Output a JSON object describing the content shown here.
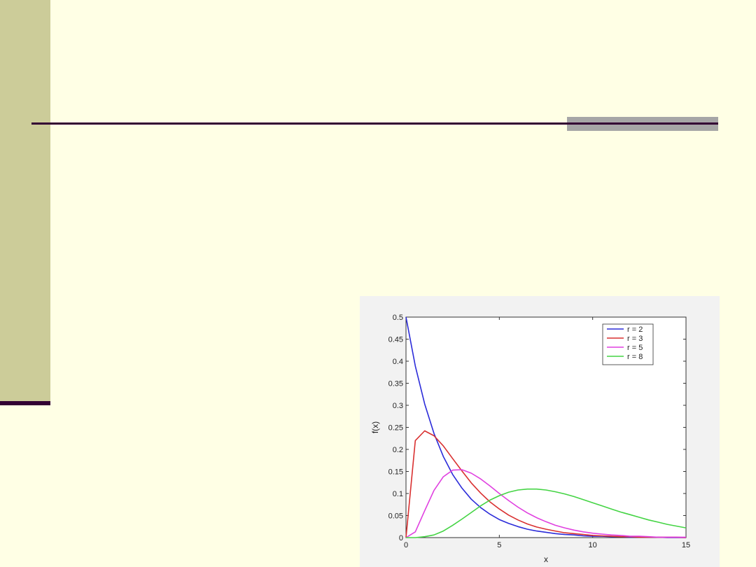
{
  "chart_data": {
    "type": "line",
    "title": "",
    "xlabel": "x",
    "ylabel": "f(x)",
    "xlim": [
      0,
      15
    ],
    "ylim": [
      0,
      0.5
    ],
    "xticks": [
      "0",
      "5",
      "10",
      "15"
    ],
    "yticks": [
      "0",
      "0.05",
      "0.1",
      "0.15",
      "0.2",
      "0.25",
      "0.3",
      "0.35",
      "0.4",
      "0.45",
      "0.5"
    ],
    "xtick_values": [
      0,
      5,
      10,
      15
    ],
    "ytick_values": [
      0,
      0.05,
      0.1,
      0.15,
      0.2,
      0.25,
      0.3,
      0.35,
      0.4,
      0.45,
      0.5
    ],
    "legend_position": "top-right",
    "grid": false,
    "x": [
      0,
      0.5,
      1,
      1.5,
      2,
      2.5,
      3,
      3.5,
      4,
      4.5,
      5,
      5.5,
      6,
      6.5,
      7,
      7.5,
      8,
      8.5,
      9,
      9.5,
      10,
      10.5,
      11,
      11.5,
      12,
      12.5,
      13,
      13.5,
      14,
      14.5,
      15
    ],
    "series": [
      {
        "name": "r = 2",
        "color": "#2B2BD9",
        "values": [
          0.5,
          0.389,
          0.303,
          0.236,
          0.184,
          0.143,
          0.112,
          0.087,
          0.068,
          0.053,
          0.041,
          0.032,
          0.025,
          0.019,
          0.015,
          0.012,
          0.009,
          0.007,
          0.006,
          0.004,
          0.003,
          0.003,
          0.002,
          0.002,
          0.001,
          0.001,
          0.001,
          0.001,
          0.0,
          0.0,
          0.0
        ]
      },
      {
        "name": "r = 3",
        "color": "#D93030",
        "values": [
          0.0,
          0.22,
          0.242,
          0.231,
          0.208,
          0.179,
          0.151,
          0.124,
          0.101,
          0.081,
          0.065,
          0.051,
          0.04,
          0.031,
          0.024,
          0.019,
          0.015,
          0.011,
          0.009,
          0.007,
          0.005,
          0.004,
          0.003,
          0.002,
          0.002,
          0.001,
          0.001,
          0.001,
          0.001,
          0.001,
          0.0
        ]
      },
      {
        "name": "r = 5",
        "color": "#E040E0",
        "values": [
          0.0,
          0.013,
          0.061,
          0.107,
          0.138,
          0.153,
          0.154,
          0.146,
          0.133,
          0.117,
          0.1,
          0.084,
          0.069,
          0.056,
          0.045,
          0.036,
          0.028,
          0.022,
          0.017,
          0.013,
          0.01,
          0.008,
          0.006,
          0.005,
          0.003,
          0.003,
          0.002,
          0.001,
          0.001,
          0.001,
          0.001
        ]
      },
      {
        "name": "r = 8",
        "color": "#44D444",
        "values": [
          0.0,
          0.0,
          0.002,
          0.006,
          0.015,
          0.028,
          0.042,
          0.057,
          0.072,
          0.085,
          0.095,
          0.103,
          0.108,
          0.11,
          0.11,
          0.108,
          0.104,
          0.099,
          0.093,
          0.086,
          0.079,
          0.072,
          0.065,
          0.058,
          0.052,
          0.046,
          0.04,
          0.035,
          0.03,
          0.026,
          0.022
        ]
      }
    ]
  }
}
